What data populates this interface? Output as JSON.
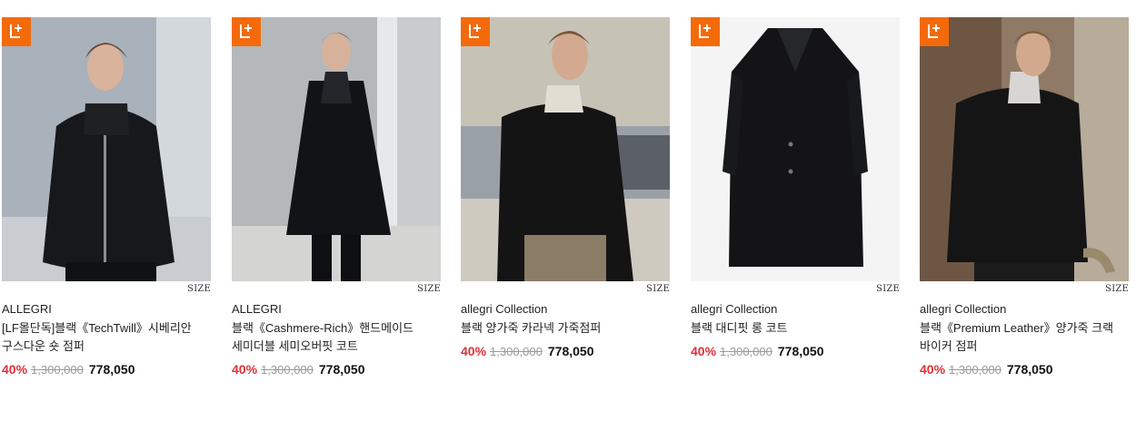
{
  "products": [
    {
      "badge_icon": "l-plus-icon",
      "size_label": "SIZE",
      "brand": "ALLEGRI",
      "title": "[LF몰단독]블랙《TechTwill》시베리안 구스다운 숏 점퍼",
      "discount": "40%",
      "original_price": "1,300,000",
      "final_price": "778,050",
      "image": "model-black-puffer-jacket"
    },
    {
      "badge_icon": "l-plus-icon",
      "size_label": "SIZE",
      "brand": "ALLEGRI",
      "title": "블랙《Cashmere-Rich》핸드메이드 세미더블 세미오버핏 코트",
      "discount": "40%",
      "original_price": "1,300,000",
      "final_price": "778,050",
      "image": "model-black-cashmere-coat"
    },
    {
      "badge_icon": "l-plus-icon",
      "size_label": "SIZE",
      "brand": "allegri Collection",
      "title": "블랙 양가죽 카라넥 가죽점퍼",
      "discount": "40%",
      "original_price": "1,300,000",
      "final_price": "778,050",
      "image": "model-black-leather-jacket"
    },
    {
      "badge_icon": "l-plus-icon",
      "size_label": "SIZE",
      "brand": "allegri Collection",
      "title": "블랙 대디핏 롱 코트",
      "discount": "40%",
      "original_price": "1,300,000",
      "final_price": "778,050",
      "image": "black-long-coat-flatlay"
    },
    {
      "badge_icon": "l-plus-icon",
      "size_label": "SIZE",
      "brand": "allegri Collection",
      "title": "블랙《Premium Leather》양가죽 크랙 바이커 점퍼",
      "discount": "40%",
      "original_price": "1,300,000",
      "final_price": "778,050",
      "image": "model-black-biker-jacket"
    }
  ],
  "colors": {
    "badge": "#f46a0b",
    "discount": "#e0303a",
    "original_price": "#9b9b9b"
  }
}
